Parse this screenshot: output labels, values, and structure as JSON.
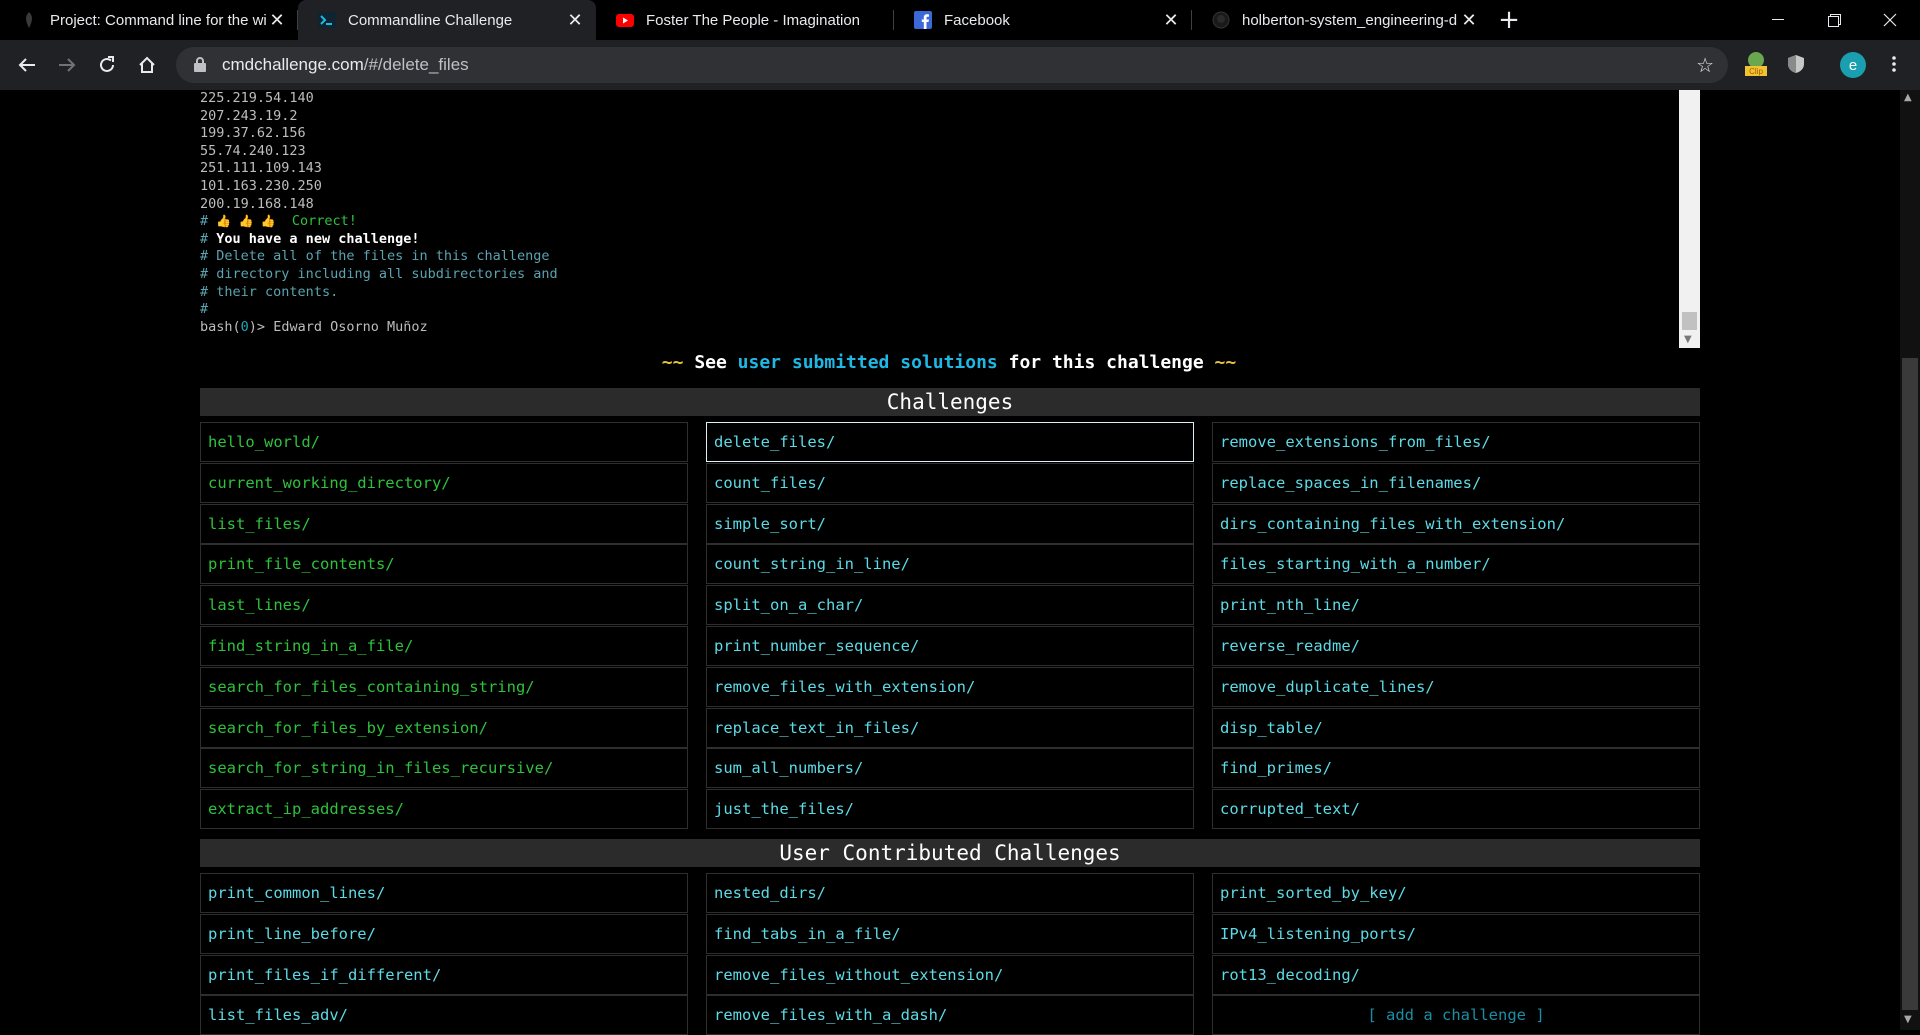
{
  "browser": {
    "tabs": [
      {
        "title": "Project: Command line for the wi",
        "favicon": "holberton-icon"
      },
      {
        "title": "Commandline Challenge",
        "favicon": "terminal-icon"
      },
      {
        "title": "Foster The People - Imagination",
        "favicon": "youtube-icon"
      },
      {
        "title": "Facebook",
        "favicon": "facebook-icon"
      },
      {
        "title": "holberton-system_engineering-d",
        "favicon": "github-icon"
      }
    ],
    "close_glyph": "✕",
    "newtab_glyph": "+",
    "url_host": "cmdchallenge.com",
    "url_path": "/#/delete_files",
    "profile_initial": "e",
    "ext_clip_label": "Clip"
  },
  "terminal": {
    "ip_lines": [
      "225.219.54.140",
      "207.243.19.2",
      "199.37.62.156",
      "55.74.240.123",
      "251.111.109.143",
      "101.163.230.250",
      "200.19.168.148"
    ],
    "hash": "#",
    "thumbs": "👍 👍 👍",
    "correct": "Correct!",
    "new_challenge": "You have a new challenge!",
    "desc_lines": [
      "Delete all of the files in this challenge",
      "directory including all subdirectories and",
      "their contents."
    ],
    "prompt_prefix": "bash(",
    "prompt_num": "0",
    "prompt_suffix": ")>",
    "prompt_input": "Edward Osorno Muñoz"
  },
  "solutions": {
    "squiggle": "~~",
    "see": "See",
    "link": "user submitted solutions",
    "rest": "for this challenge"
  },
  "challenges": {
    "title": "Challenges",
    "columns": [
      [
        "hello_world/",
        "current_working_directory/",
        "list_files/",
        "print_file_contents/",
        "last_lines/",
        "find_string_in_a_file/",
        "search_for_files_containing_string/",
        "search_for_files_by_extension/",
        "search_for_string_in_files_recursive/",
        "extract_ip_addresses/"
      ],
      [
        "delete_files/",
        "count_files/",
        "simple_sort/",
        "count_string_in_line/",
        "split_on_a_char/",
        "print_number_sequence/",
        "remove_files_with_extension/",
        "replace_text_in_files/",
        "sum_all_numbers/",
        "just_the_files/"
      ],
      [
        "remove_extensions_from_files/",
        "replace_spaces_in_filenames/",
        "dirs_containing_files_with_extension/",
        "files_starting_with_a_number/",
        "print_nth_line/",
        "reverse_readme/",
        "remove_duplicate_lines/",
        "disp_table/",
        "find_primes/",
        "corrupted_text/"
      ]
    ]
  },
  "user_challenges": {
    "title": "User Contributed Challenges",
    "columns": [
      [
        "print_common_lines/",
        "print_line_before/",
        "print_files_if_different/",
        "list_files_adv/"
      ],
      [
        "nested_dirs/",
        "find_tabs_in_a_file/",
        "remove_files_without_extension/",
        "remove_files_with_a_dash/"
      ],
      [
        "print_sorted_by_key/",
        "IPv4_listening_ports/",
        "rot13_decoding/"
      ]
    ],
    "add_label": "[ add a challenge ]"
  },
  "colors": {
    "solved": "#2ec23b",
    "unsolved": "#5cdbe6",
    "link": "#1fb8e6"
  }
}
